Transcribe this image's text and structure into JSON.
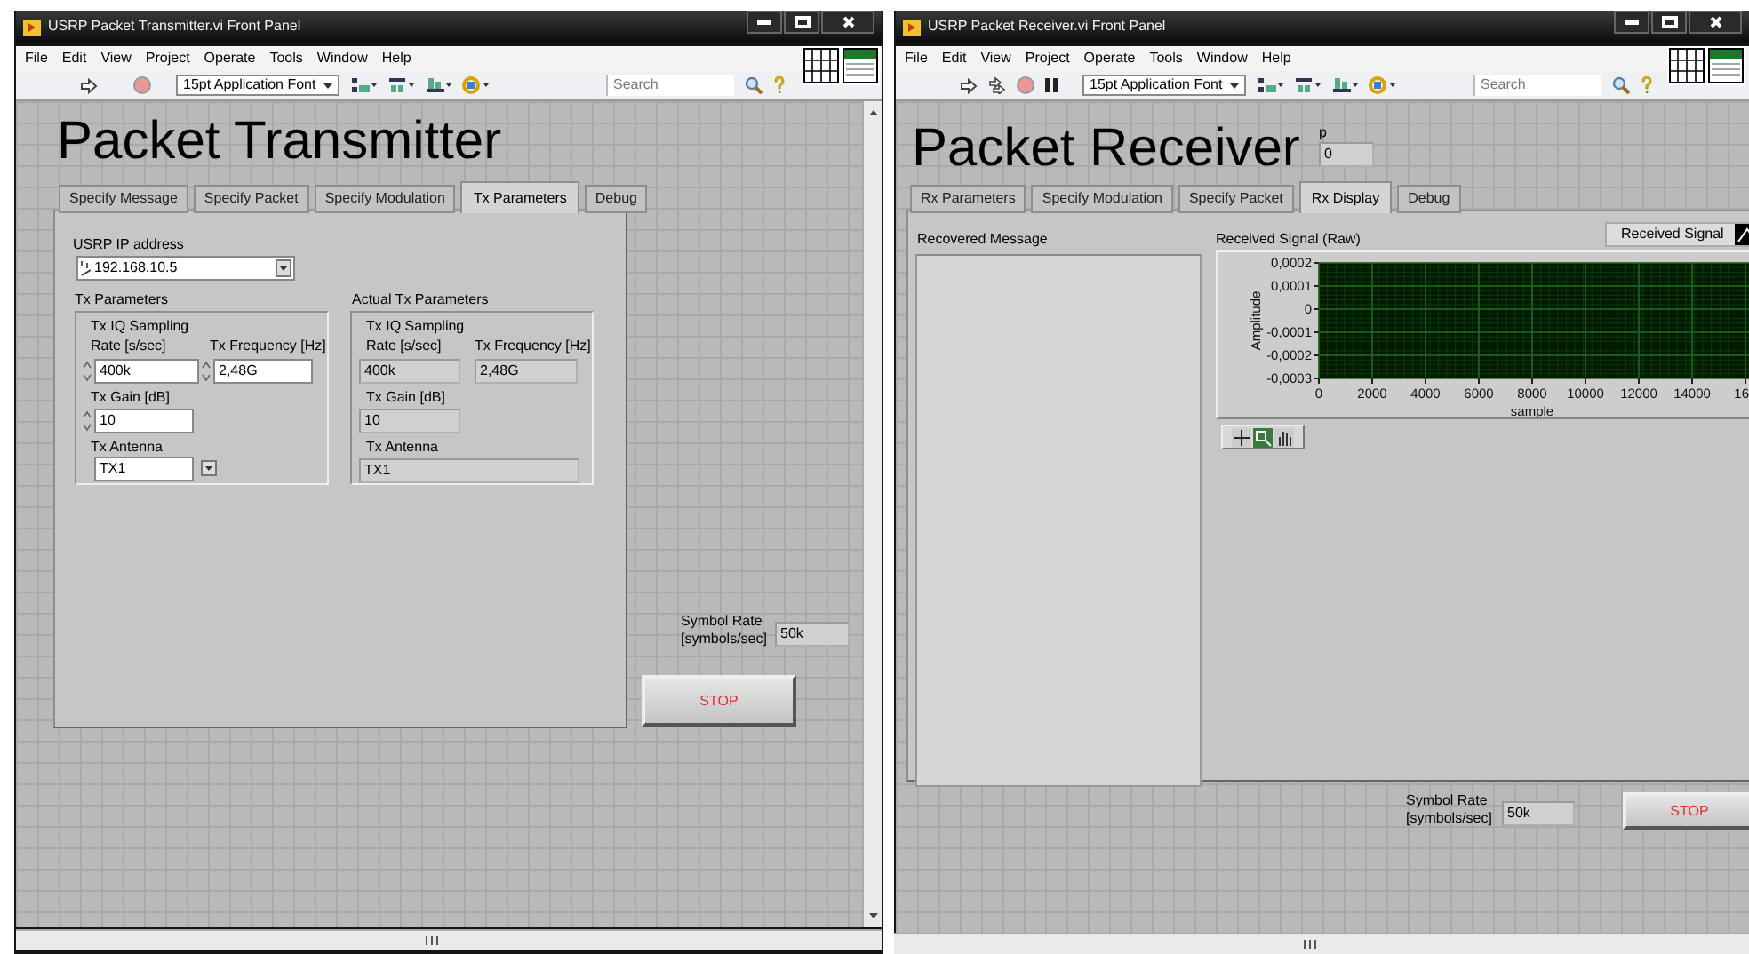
{
  "transmitter": {
    "title": "USRP Packet Transmitter.vi Front Panel",
    "menu": [
      "File",
      "Edit",
      "View",
      "Project",
      "Operate",
      "Tools",
      "Window",
      "Help"
    ],
    "toolbar": {
      "font": "15pt Application Font",
      "search_placeholder": "Search"
    },
    "heading": "Packet Transmitter",
    "tabs": [
      {
        "label": "Specify Message",
        "selected": false
      },
      {
        "label": "Specify Packet",
        "selected": false
      },
      {
        "label": "Specify Modulation",
        "selected": false
      },
      {
        "label": "Tx Parameters",
        "selected": true
      },
      {
        "label": "Debug",
        "selected": false
      }
    ],
    "usrp_ip": {
      "label": "USRP IP address",
      "value": "192.168.10.5"
    },
    "tx_parameters": {
      "title": "Tx Parameters",
      "rate_label": [
        "Tx IQ Sampling",
        "Rate [s/sec]"
      ],
      "rate": "400k",
      "frequency_label": "Tx Frequency [Hz]",
      "frequency": "2,48G",
      "gain_label": "Tx Gain [dB]",
      "gain": "10",
      "antenna_label": "Tx Antenna",
      "antenna": "TX1"
    },
    "actual_tx_parameters": {
      "title": "Actual Tx Parameters",
      "rate_label": [
        "Tx IQ Sampling",
        "Rate [s/sec]"
      ],
      "rate": "400k",
      "frequency_label": "Tx Frequency [Hz]",
      "frequency": "2,48G",
      "gain_label": "Tx Gain [dB]",
      "gain": "10",
      "antenna_label": "Tx Antenna",
      "antenna": "TX1"
    },
    "symbol_rate": {
      "label": [
        "Symbol Rate",
        "[symbols/sec]"
      ],
      "value": "50k"
    },
    "stop_button": "STOP"
  },
  "receiver": {
    "title": "USRP Packet Receiver.vi Front Panel",
    "menu": [
      "File",
      "Edit",
      "View",
      "Project",
      "Operate",
      "Tools",
      "Window",
      "Help"
    ],
    "toolbar": {
      "font": "15pt Application Font",
      "search_placeholder": "Search"
    },
    "heading": "Packet Receiver",
    "p_indicator": {
      "label": "p",
      "value": "0"
    },
    "tabs": [
      {
        "label": "Rx Parameters",
        "selected": false
      },
      {
        "label": "Specify Modulation",
        "selected": false
      },
      {
        "label": "Specify Packet",
        "selected": false
      },
      {
        "label": "Rx Display",
        "selected": true
      },
      {
        "label": "Debug",
        "selected": false
      }
    ],
    "recovered_message": {
      "label": "Recovered Message"
    },
    "graph": {
      "chart_data": {
        "type": "line",
        "title": "Received Signal (Raw)",
        "xlabel": "sample",
        "ylabel": "Amplitude",
        "ylim": [
          -0.0003,
          0.0002
        ],
        "yticks": [
          {
            "value": 0.0002,
            "label": "0,0002"
          },
          {
            "value": 0.0001,
            "label": "0,0001"
          },
          {
            "value": 0,
            "label": "0"
          },
          {
            "value": -0.0001,
            "label": "-0,0001"
          },
          {
            "value": -0.0002,
            "label": "-0,0002"
          },
          {
            "value": -0.0003,
            "label": "-0,0003"
          }
        ],
        "categories": [
          "0",
          "2000",
          "4000",
          "6000",
          "8000",
          "10000",
          "12000",
          "14000",
          "16"
        ],
        "grid": true,
        "series": [
          {
            "name": "Received Signal",
            "color": "#ffffff",
            "values": [
              null,
              null,
              null,
              null,
              null,
              null,
              null,
              null,
              null
            ]
          }
        ]
      }
    },
    "symbol_rate": {
      "label": [
        "Symbol Rate",
        "[symbols/sec]"
      ],
      "value": "50k"
    },
    "stop_button": "STOP"
  }
}
